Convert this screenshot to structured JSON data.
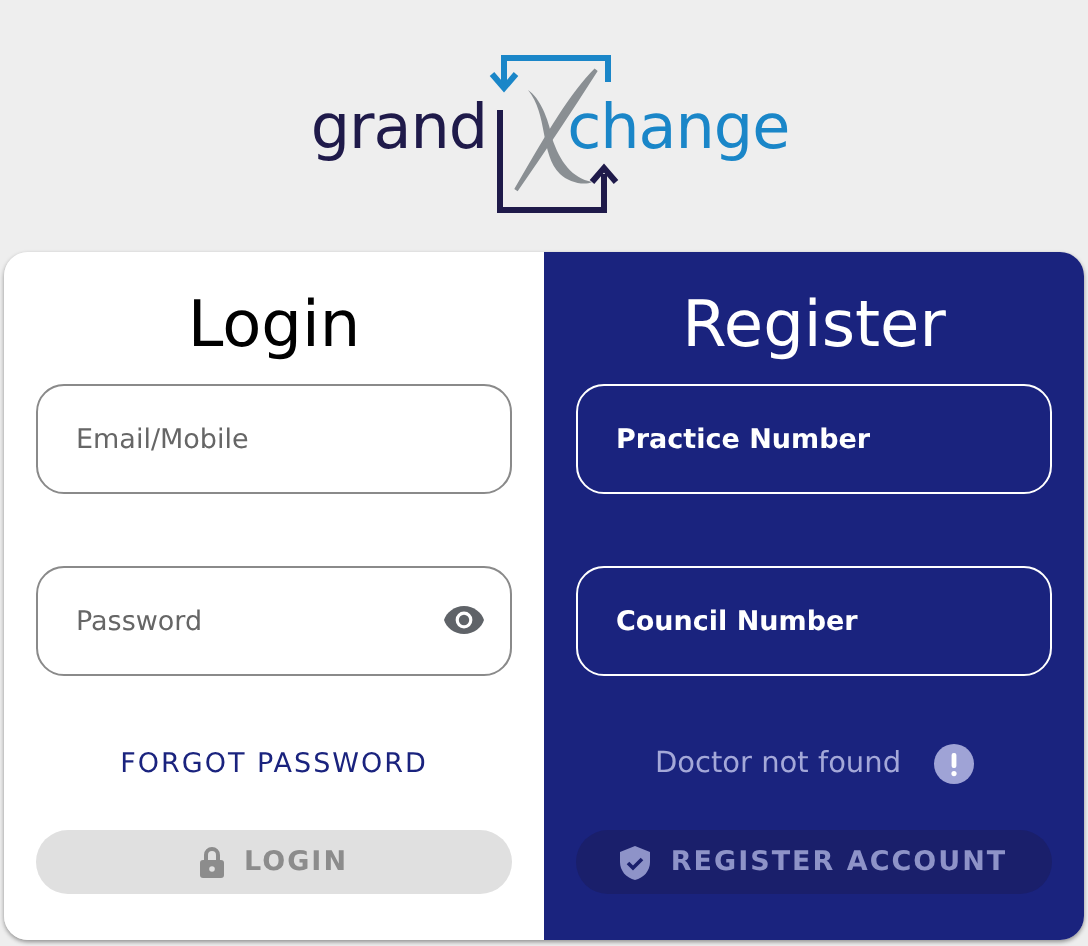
{
  "logo": {
    "text_left": "grand",
    "text_right": "change"
  },
  "login": {
    "title": "Login",
    "fields": [
      {
        "placeholder": "Email/Mobile",
        "kind": "text"
      },
      {
        "placeholder": "Password",
        "kind": "password"
      }
    ],
    "link": "FORGOT PASSWORD",
    "button": {
      "label": "LOGIN",
      "disabled": true
    }
  },
  "register": {
    "title": "Register",
    "fields": [
      {
        "placeholder": "Practice Number",
        "kind": "text"
      },
      {
        "placeholder": "Council Number",
        "kind": "text"
      }
    ],
    "message": "Doctor not found",
    "button": {
      "label": "REGISTER ACCOUNT",
      "disabled": true
    }
  }
}
